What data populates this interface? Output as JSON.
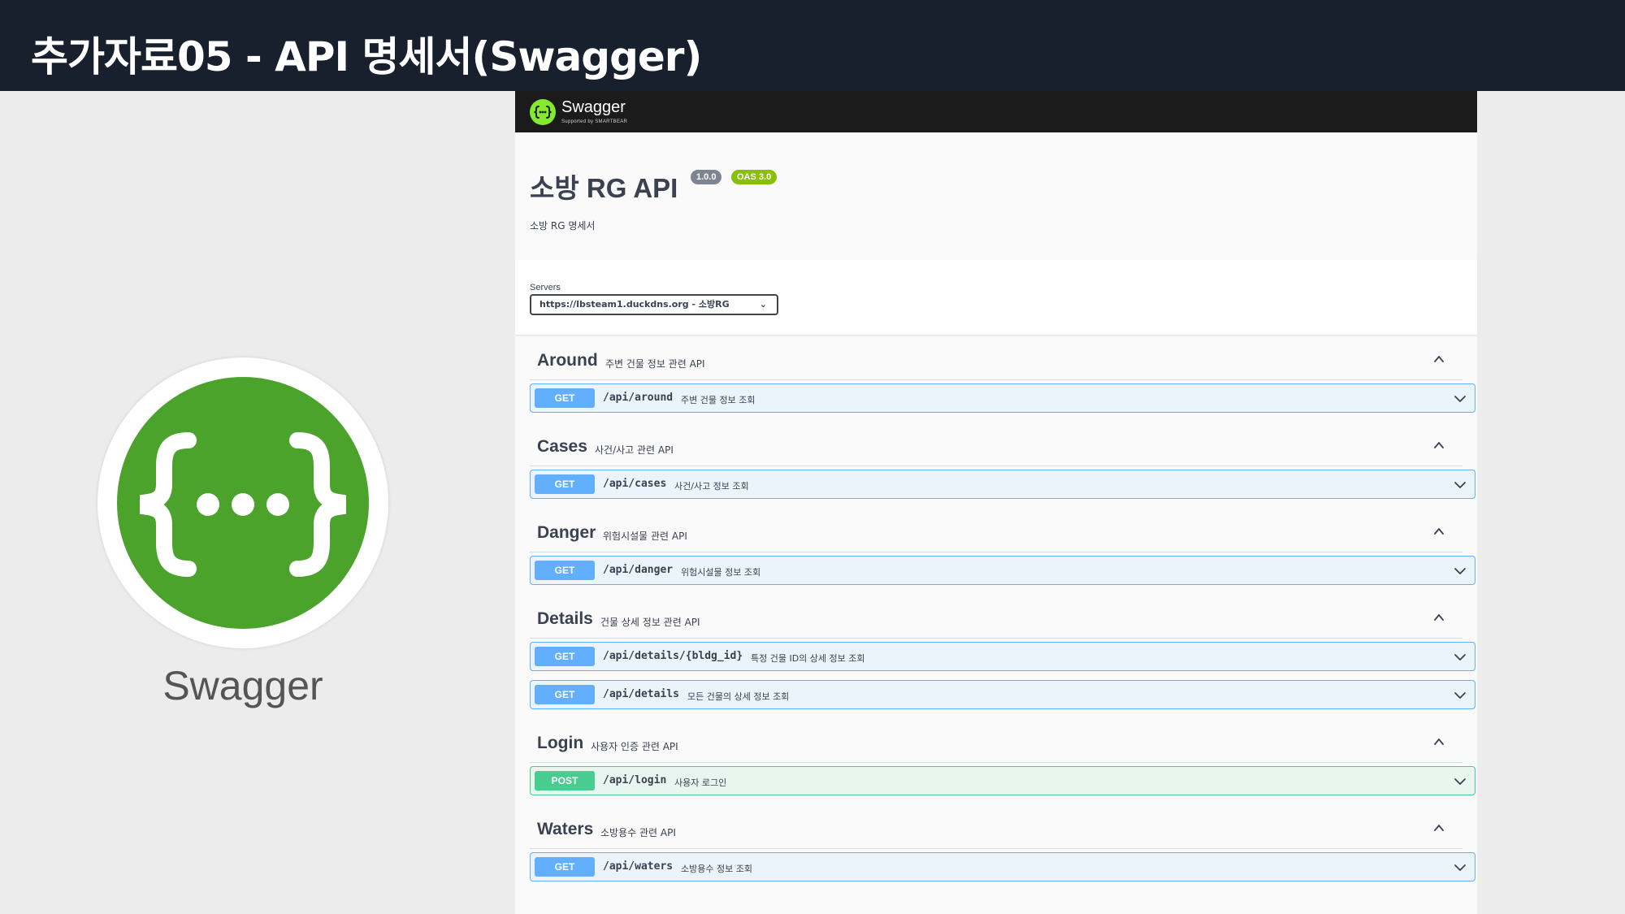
{
  "slide": {
    "title": "추가자료05 - API 명세서(Swagger)",
    "logo_caption": "Swagger"
  },
  "swagger": {
    "topbar": {
      "logo_text": "Swagger",
      "logo_sub": "Supported by SMARTBEAR"
    },
    "info": {
      "title": "소방 RG API",
      "version": "1.0.0",
      "oas": "OAS 3.0",
      "description": "소방 RG 명세서"
    },
    "servers": {
      "label": "Servers",
      "selected": "https://lbsteam1.duckdns.org - 소방RG"
    },
    "tags": [
      {
        "name": "Around",
        "description": "주변 건물 정보 관련 API",
        "operations": [
          {
            "method": "GET",
            "path": "/api/around",
            "summary": "주변 건물 정보 조회"
          }
        ]
      },
      {
        "name": "Cases",
        "description": "사건/사고 관련 API",
        "operations": [
          {
            "method": "GET",
            "path": "/api/cases",
            "summary": "사건/사고 정보 조회"
          }
        ]
      },
      {
        "name": "Danger",
        "description": "위험시설물 관련 API",
        "operations": [
          {
            "method": "GET",
            "path": "/api/danger",
            "summary": "위험시설물 정보 조회"
          }
        ]
      },
      {
        "name": "Details",
        "description": "건물 상세 정보 관련 API",
        "operations": [
          {
            "method": "GET",
            "path": "/api/details/{bldg_id}",
            "summary": "특정 건물 ID의 상세 정보 조회"
          },
          {
            "method": "GET",
            "path": "/api/details",
            "summary": "모든 건물의 상세 정보 조회"
          }
        ]
      },
      {
        "name": "Login",
        "description": "사용자 인증 관련 API",
        "operations": [
          {
            "method": "POST",
            "path": "/api/login",
            "summary": "사용자 로그인"
          }
        ]
      },
      {
        "name": "Waters",
        "description": "소방용수 관련 API",
        "operations": [
          {
            "method": "GET",
            "path": "/api/waters",
            "summary": "소방용수 정보 조회"
          }
        ]
      }
    ]
  },
  "colors": {
    "header_bg": "#17202c",
    "swagger_green": "#4ba32c",
    "get": "#61affe",
    "post": "#49cc90",
    "badge_version": "#7d8492",
    "badge_oas": "#89bf04"
  },
  "icons": {
    "logo": "swagger-logo-icon",
    "tag_toggle": "chevron-up-icon",
    "op_toggle": "chevron-down-icon",
    "select": "chevron-down-icon"
  }
}
